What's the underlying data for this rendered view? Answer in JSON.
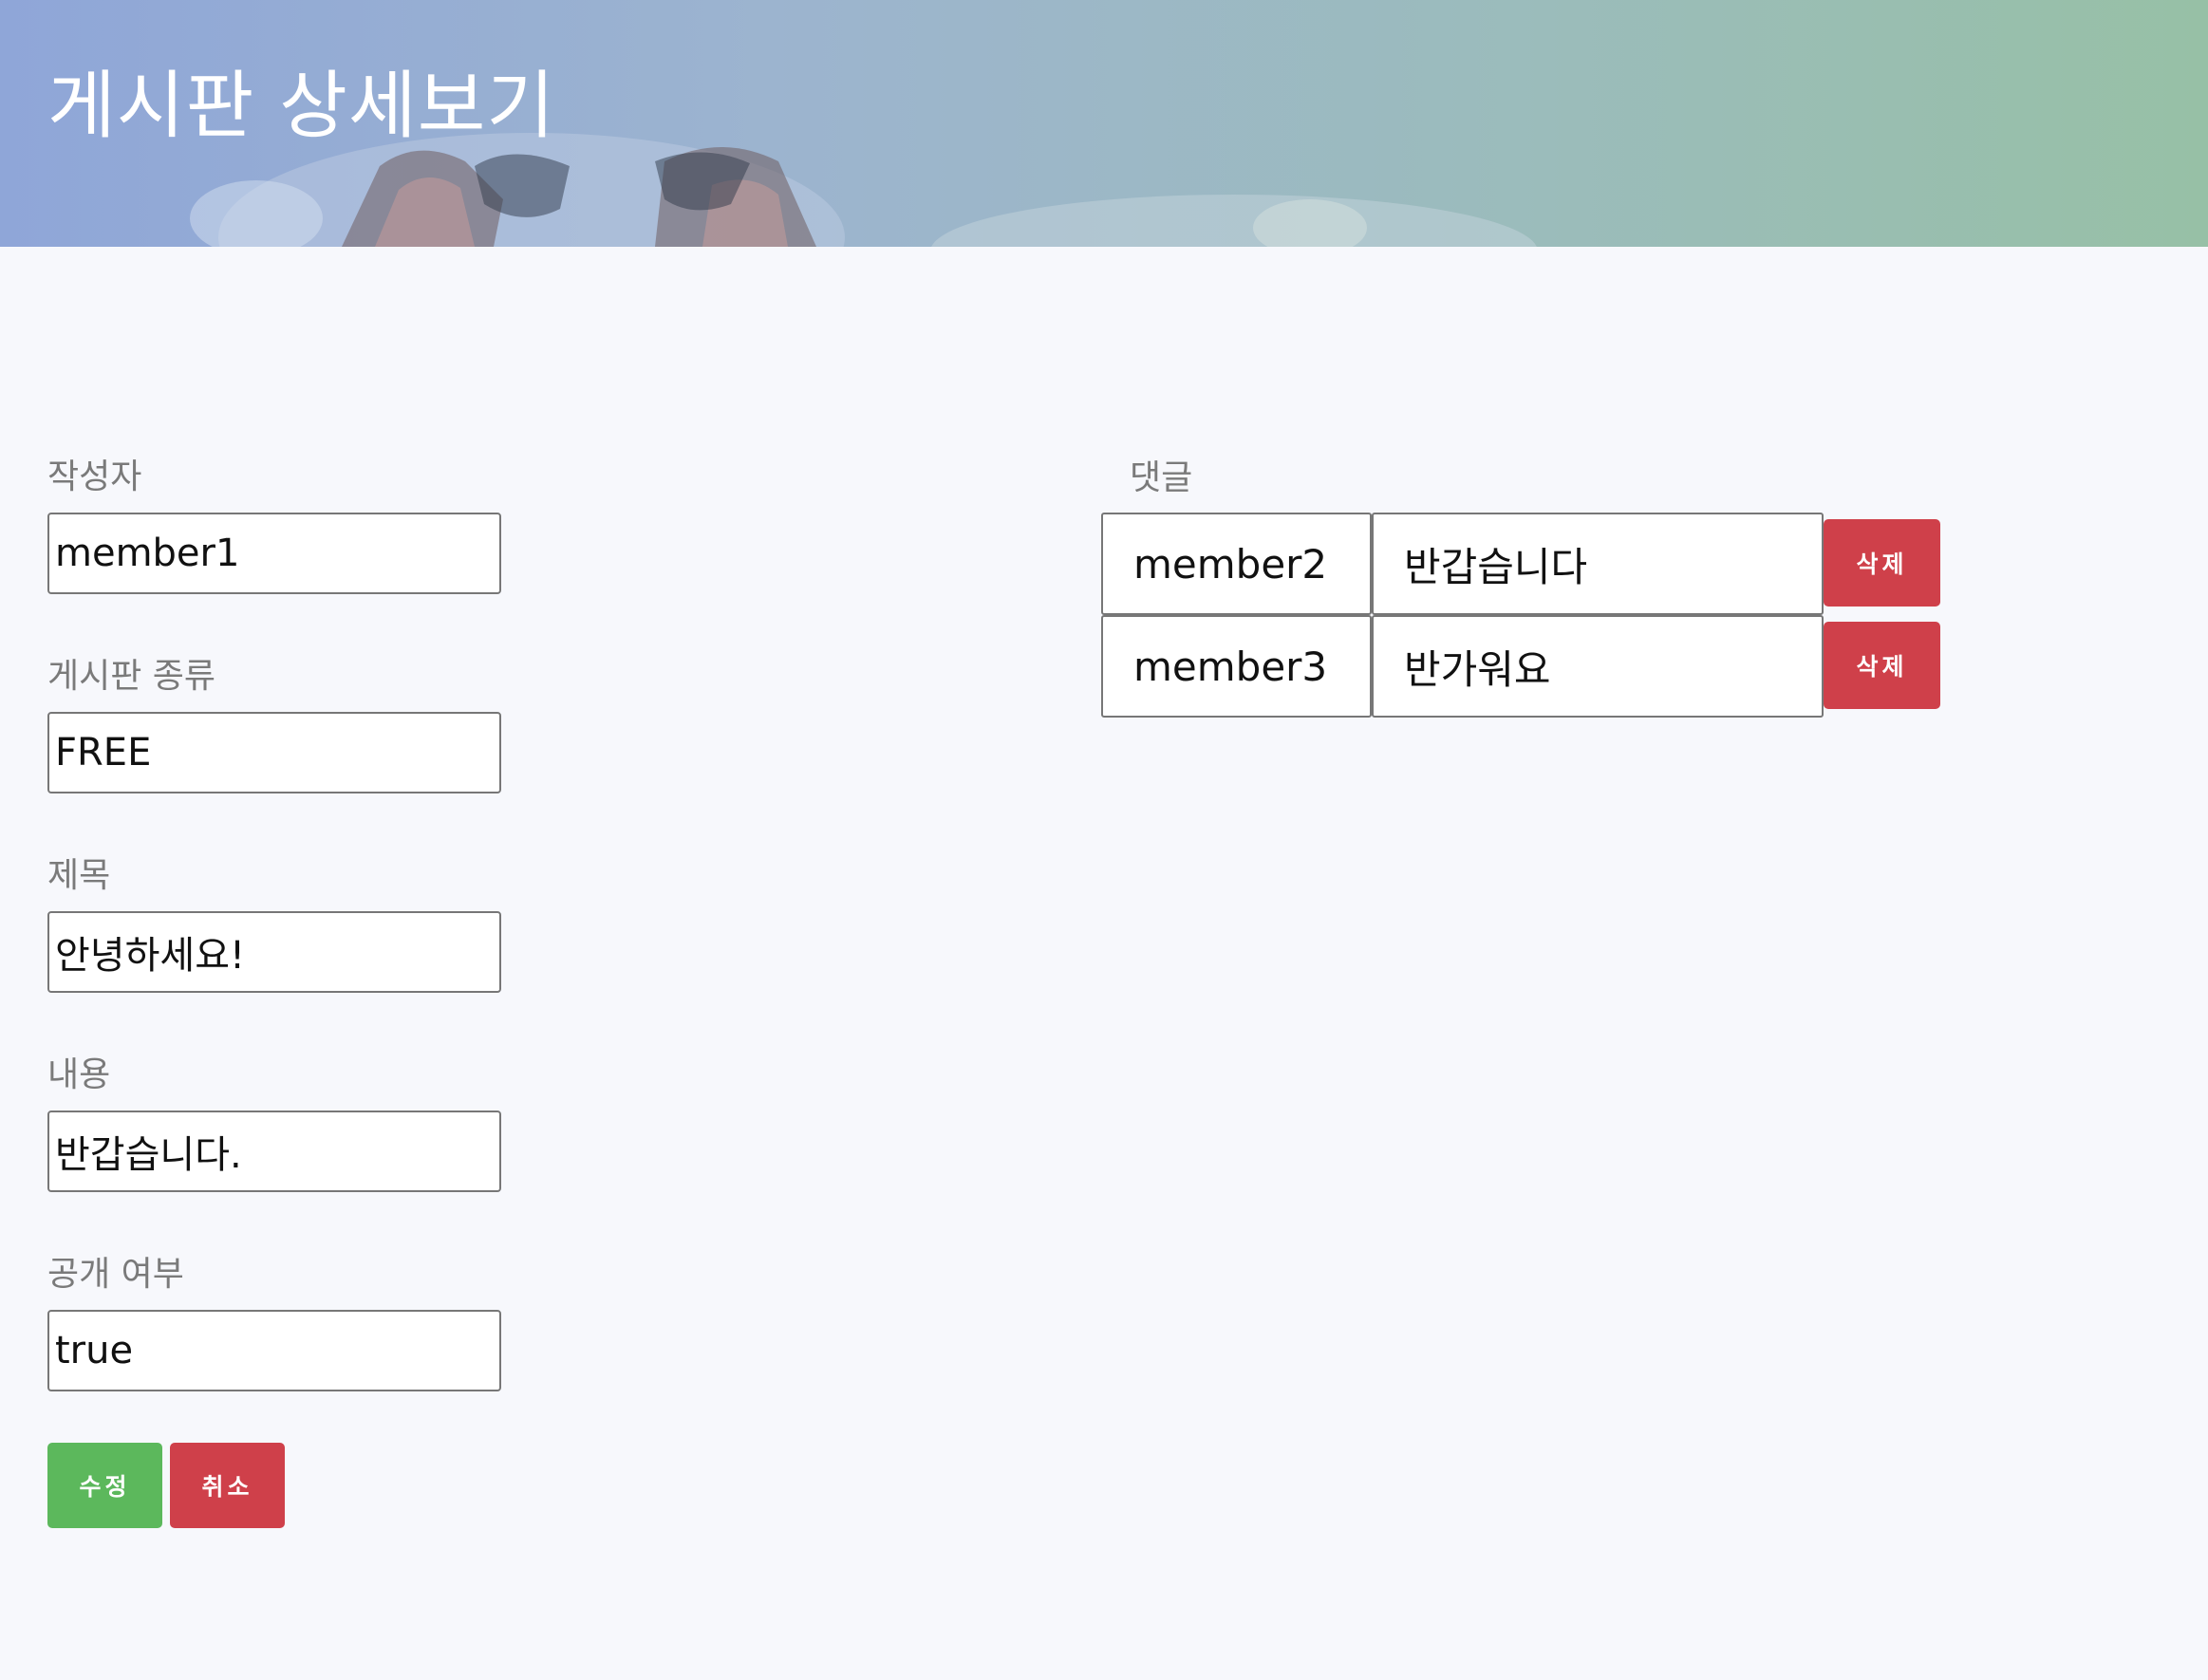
{
  "header": {
    "title": "게시판 상세보기"
  },
  "form": {
    "writer": {
      "label": "작성자",
      "value": "member1"
    },
    "board_type": {
      "label": "게시판 종류",
      "value": "FREE"
    },
    "subject": {
      "label": "제목",
      "value": "안녕하세요!"
    },
    "content": {
      "label": "내용",
      "value": "반갑습니다."
    },
    "is_public": {
      "label": "공개 여부",
      "value": "true"
    },
    "buttons": {
      "edit_label": "수정",
      "cancel_label": "취소"
    }
  },
  "comments": {
    "label": "댓글",
    "delete_label": "삭제",
    "items": [
      {
        "author": "member2",
        "text": "반갑습니다"
      },
      {
        "author": "member3",
        "text": "반가워요"
      }
    ]
  },
  "colors": {
    "edit_button": "#5cb85c",
    "delete_button": "#cf404a",
    "page_background": "#f7f8fc"
  }
}
